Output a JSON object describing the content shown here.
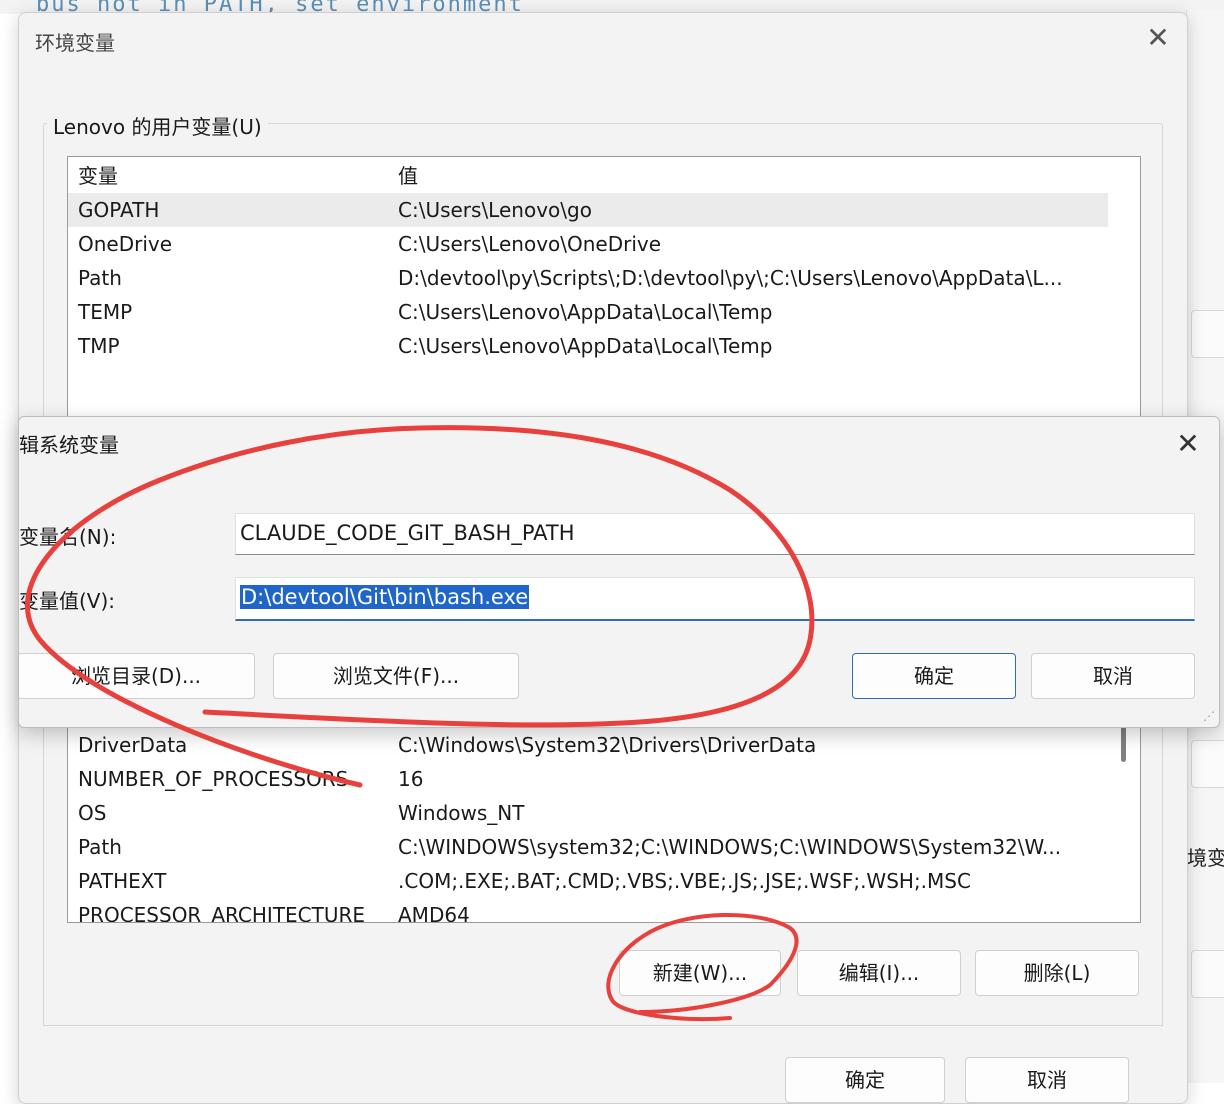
{
  "background": {
    "terminal_snippet": "bus not in PATH, set environment",
    "side_text": "境变"
  },
  "env_dialog": {
    "title": "环境变量",
    "close": "✕",
    "user_group_label": "Lenovo 的用户变量(U)",
    "user_vars": {
      "header": [
        "变量",
        "值"
      ],
      "rows": [
        {
          "name": "GOPATH",
          "value": "C:\\Users\\Lenovo\\go",
          "selected": true
        },
        {
          "name": "OneDrive",
          "value": "C:\\Users\\Lenovo\\OneDrive"
        },
        {
          "name": "Path",
          "value": "D:\\devtool\\py\\Scripts\\;D:\\devtool\\py\\;C:\\Users\\Lenovo\\AppData\\L..."
        },
        {
          "name": "TEMP",
          "value": "C:\\Users\\Lenovo\\AppData\\Local\\Temp"
        },
        {
          "name": "TMP",
          "value": "C:\\Users\\Lenovo\\AppData\\Local\\Temp"
        }
      ]
    },
    "system_vars": {
      "rows": [
        {
          "name": "DriverData",
          "value": "C:\\Windows\\System32\\Drivers\\DriverData"
        },
        {
          "name": "NUMBER_OF_PROCESSORS",
          "value": "16"
        },
        {
          "name": "OS",
          "value": "Windows_NT"
        },
        {
          "name": "Path",
          "value": "C:\\WINDOWS\\system32;C:\\WINDOWS;C:\\WINDOWS\\System32\\W..."
        },
        {
          "name": "PATHEXT",
          "value": ".COM;.EXE;.BAT;.CMD;.VBS;.VBE;.JS;.JSE;.WSF;.WSH;.MSC"
        },
        {
          "name": "PROCESSOR_ARCHITECTURE",
          "value": "AMD64"
        }
      ]
    },
    "buttons": {
      "new": "新建(W)...",
      "edit": "编辑(I)...",
      "delete": "删除(L)",
      "ok": "确定",
      "cancel": "取消"
    }
  },
  "edit_dialog": {
    "title": "辑系统变量",
    "close": "✕",
    "name_label": "变量名(N):",
    "value_label": "变量值(V):",
    "name_value": "CLAUDE_CODE_GIT_BASH_PATH",
    "value_value": "D:\\devtool\\Git\\bin\\bash.exe",
    "buttons": {
      "browse_dir": "浏览目录(D)...",
      "browse_file": "浏览文件(F)...",
      "ok": "确定",
      "cancel": "取消"
    }
  },
  "annotations": {
    "color": "#e8403c"
  }
}
